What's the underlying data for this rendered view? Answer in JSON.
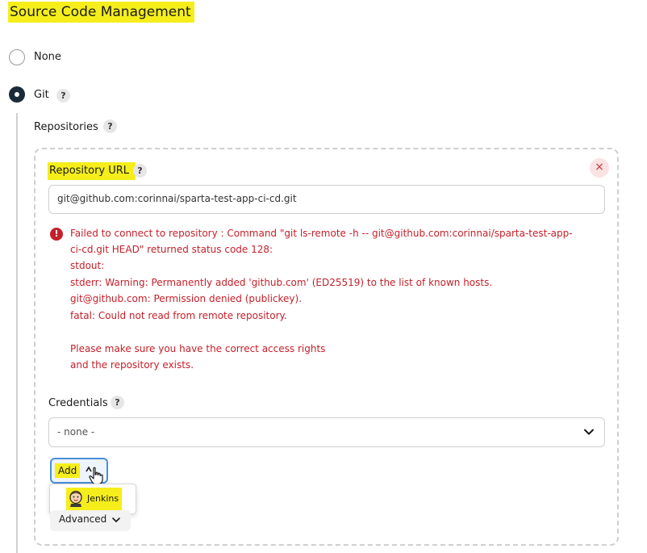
{
  "section": {
    "title": "Source Code Management"
  },
  "scm_options": [
    {
      "label": "None",
      "selected": false
    },
    {
      "label": "Git",
      "selected": true
    }
  ],
  "help_glyph": "?",
  "repositories": {
    "label": "Repositories",
    "repository_url": {
      "label": "Repository URL",
      "value": "git@github.com:corinnai/sparta-test-app-ci-cd.git"
    },
    "close_glyph": "×",
    "error": {
      "icon_glyph": "!",
      "lines": [
        "Failed to connect to repository : Command \"git ls-remote -h -- git@github.com:corinnai/sparta-test-app-",
        "ci-cd.git HEAD\" returned status code 128:",
        "stdout:",
        "stderr: Warning: Permanently added 'github.com' (ED25519) to the list of known hosts.",
        "git@github.com: Permission denied (publickey).",
        "fatal: Could not read from remote repository.",
        "",
        "Please make sure you have the correct access rights",
        "and the repository exists."
      ]
    },
    "credentials": {
      "label": "Credentials",
      "selected": "- none -",
      "add_button": "Add",
      "add_menu_items": [
        "Jenkins"
      ]
    },
    "advanced_label": "Advanced"
  },
  "colors": {
    "highlight": "#f5ee1b",
    "error": "#c4202a",
    "radio_selected": "#1a2b3a"
  }
}
